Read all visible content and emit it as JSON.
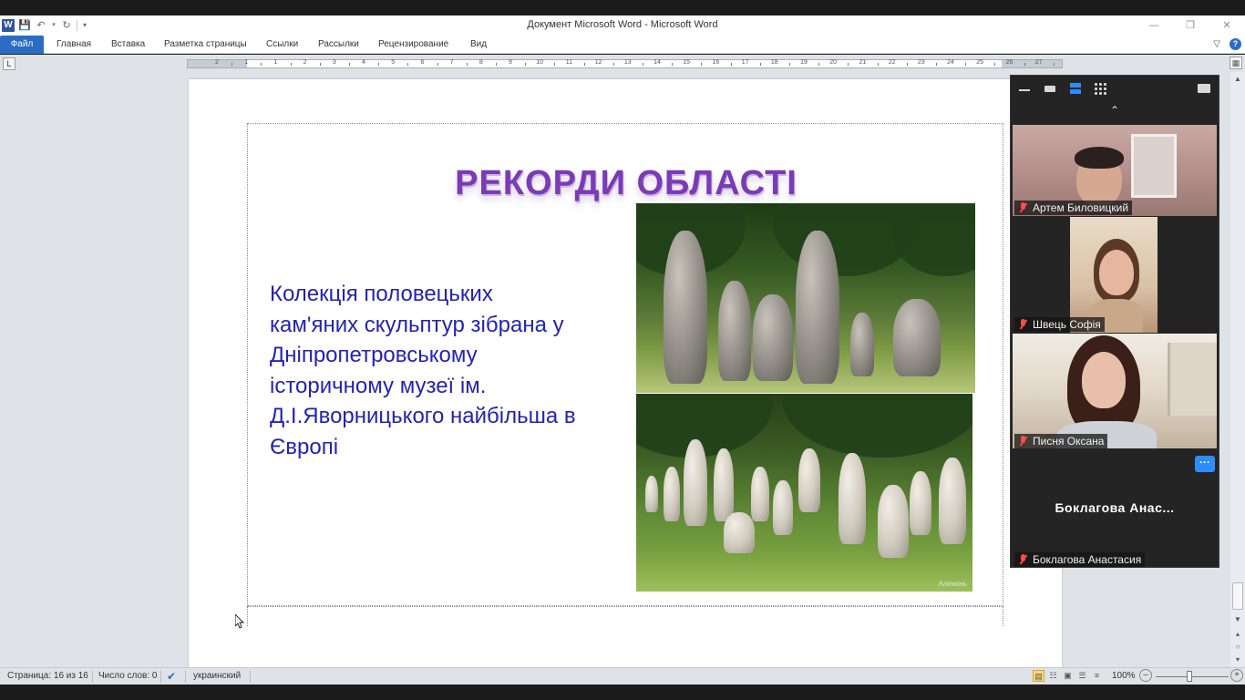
{
  "window": {
    "title": "Документ Microsoft Word  -  Microsoft Word",
    "app_icon": "W"
  },
  "ribbon": {
    "tabs": [
      "Файл",
      "Главная",
      "Вставка",
      "Разметка страницы",
      "Ссылки",
      "Рассылки",
      "Рецензирование",
      "Вид"
    ]
  },
  "ruler": {
    "labels": [
      "2",
      "1",
      "1",
      "2",
      "3",
      "4",
      "5",
      "6",
      "7",
      "8",
      "9",
      "10",
      "11",
      "12",
      "13",
      "14",
      "15",
      "16",
      "17",
      "18",
      "19",
      "20",
      "21",
      "22",
      "23",
      "24",
      "25",
      "26",
      "27"
    ]
  },
  "slide": {
    "title": "РЕКОРДИ ОБЛАСТІ",
    "lines": [
      "Колекція половецьких",
      "кам'яних скульптур зібрана у",
      "Дніпропетровському",
      "історичному музеї ім.",
      "Д.І.Яворницького найбільша в",
      "Європі"
    ],
    "watermark": "Алюмінь"
  },
  "statusbar": {
    "page": "Страница: 16 из 16",
    "words": "Число слов: 0",
    "language": "украинский",
    "zoom": "100%"
  },
  "zoom_panel": {
    "participants": [
      {
        "name": "Артем Биловицкий",
        "muted": true
      },
      {
        "name": "Швець Софія",
        "muted": true
      },
      {
        "name": "Писня Оксана",
        "muted": true
      },
      {
        "name": "Боклагова Анастасия",
        "muted": true
      }
    ],
    "no_video_label": "Боклагова  Анас...",
    "more_label": "···"
  },
  "colors": {
    "accent": "#2b6cc4",
    "slide_title": "#7b3bb4",
    "slide_text": "#2323b4",
    "zoom_blue": "#2d8cff",
    "mute_red": "#ff4b4b"
  }
}
